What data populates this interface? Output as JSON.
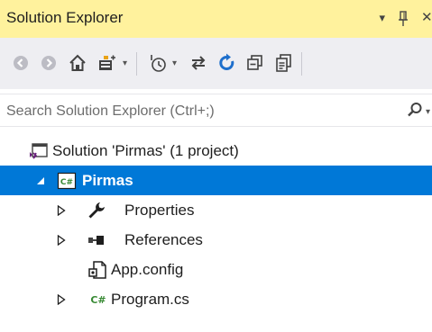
{
  "window": {
    "title": "Solution Explorer",
    "controls": {
      "dropdown_glyph": "▾",
      "pin_glyph": "⊣",
      "close_glyph": "✕"
    }
  },
  "toolbar": {
    "buttons": [
      {
        "name": "back-icon"
      },
      {
        "name": "forward-icon"
      },
      {
        "name": "home-icon"
      },
      {
        "name": "switch-views-icon"
      },
      {
        "name": "pending-changes-filter-icon"
      },
      {
        "name": "sync-with-active-document-icon"
      },
      {
        "name": "refresh-icon"
      },
      {
        "name": "collapse-all-icon"
      },
      {
        "name": "show-all-files-icon"
      }
    ]
  },
  "search": {
    "placeholder": "Search Solution Explorer (Ctrl+;)"
  },
  "tree": {
    "solution": {
      "label": "Solution 'Pirmas' (1 project)",
      "icon": "solution-icon"
    },
    "project": {
      "label": "Pirmas",
      "icon": "csharp-project-icon",
      "selected": true,
      "expanded": true
    },
    "items": [
      {
        "label": "Properties",
        "icon": "wrench-icon",
        "expandable": true
      },
      {
        "label": "References",
        "icon": "references-icon",
        "expandable": true
      },
      {
        "label": "App.config",
        "icon": "config-file-icon",
        "expandable": false
      },
      {
        "label": "Program.cs",
        "icon": "csharp-file-icon",
        "expandable": true
      }
    ]
  },
  "colors": {
    "title_bg": "#fff29d",
    "toolbar_bg": "#eeeef2",
    "selection_bg": "#0078d7",
    "refresh_blue": "#1e6fcc",
    "csharp_green": "#388a34",
    "solution_purple": "#68217a"
  }
}
